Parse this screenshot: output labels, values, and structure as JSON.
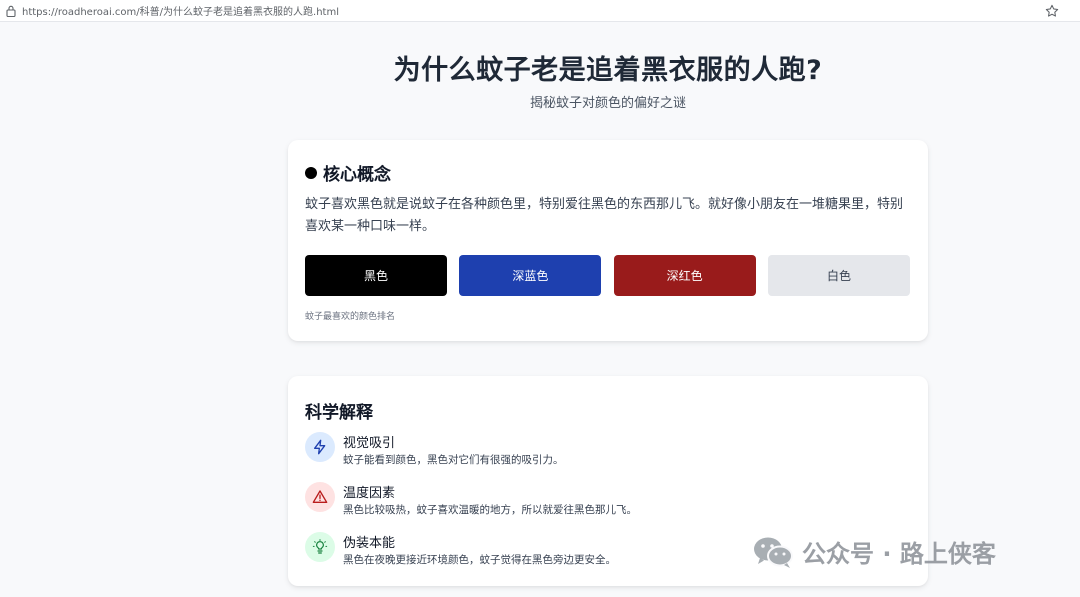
{
  "browser": {
    "url": "https://roadheroai.com/科普/为什么蚊子老是追着黑衣服的人跑.html"
  },
  "page": {
    "title": "为什么蚊子老是追着黑衣服的人跑?",
    "subtitle": "揭秘蚊子对颜色的偏好之谜"
  },
  "core": {
    "heading": "核心概念",
    "description": "蚊子喜欢黑色就是说蚊子在各种颜色里，特别爱往黑色的东西那儿飞。就好像小朋友在一堆糖果里，特别喜欢某一种口味一样。",
    "swatches": [
      {
        "label": "黑色",
        "bg": "#000000",
        "fg": "#ffffff"
      },
      {
        "label": "深蓝色",
        "bg": "#1e40af",
        "fg": "#ffffff"
      },
      {
        "label": "深红色",
        "bg": "#991b1b",
        "fg": "#ffffff"
      },
      {
        "label": "白色",
        "bg": "#e5e7eb",
        "fg": "#374151"
      }
    ],
    "caption": "蚊子最喜欢的颜色排名"
  },
  "science": {
    "heading": "科学解释",
    "items": [
      {
        "title": "视觉吸引",
        "text": "蚊子能看到颜色，黑色对它们有很强的吸引力。",
        "icon": "lightning-icon",
        "badge_bg": "#dbeafe",
        "icon_color": "#1e40af"
      },
      {
        "title": "温度因素",
        "text": "黑色比较吸热，蚊子喜欢温暖的地方，所以就爱往黑色那儿飞。",
        "icon": "warning-icon",
        "badge_bg": "#fee2e2",
        "icon_color": "#b91c1c"
      },
      {
        "title": "伪装本能",
        "text": "黑色在夜晚更接近环境颜色，蚊子觉得在黑色旁边更安全。",
        "icon": "lightbulb-icon",
        "badge_bg": "#dcfce7",
        "icon_color": "#15803d"
      }
    ]
  },
  "watermark": {
    "text": "公众号 · 路上侠客",
    "icon": "wechat-icon"
  }
}
